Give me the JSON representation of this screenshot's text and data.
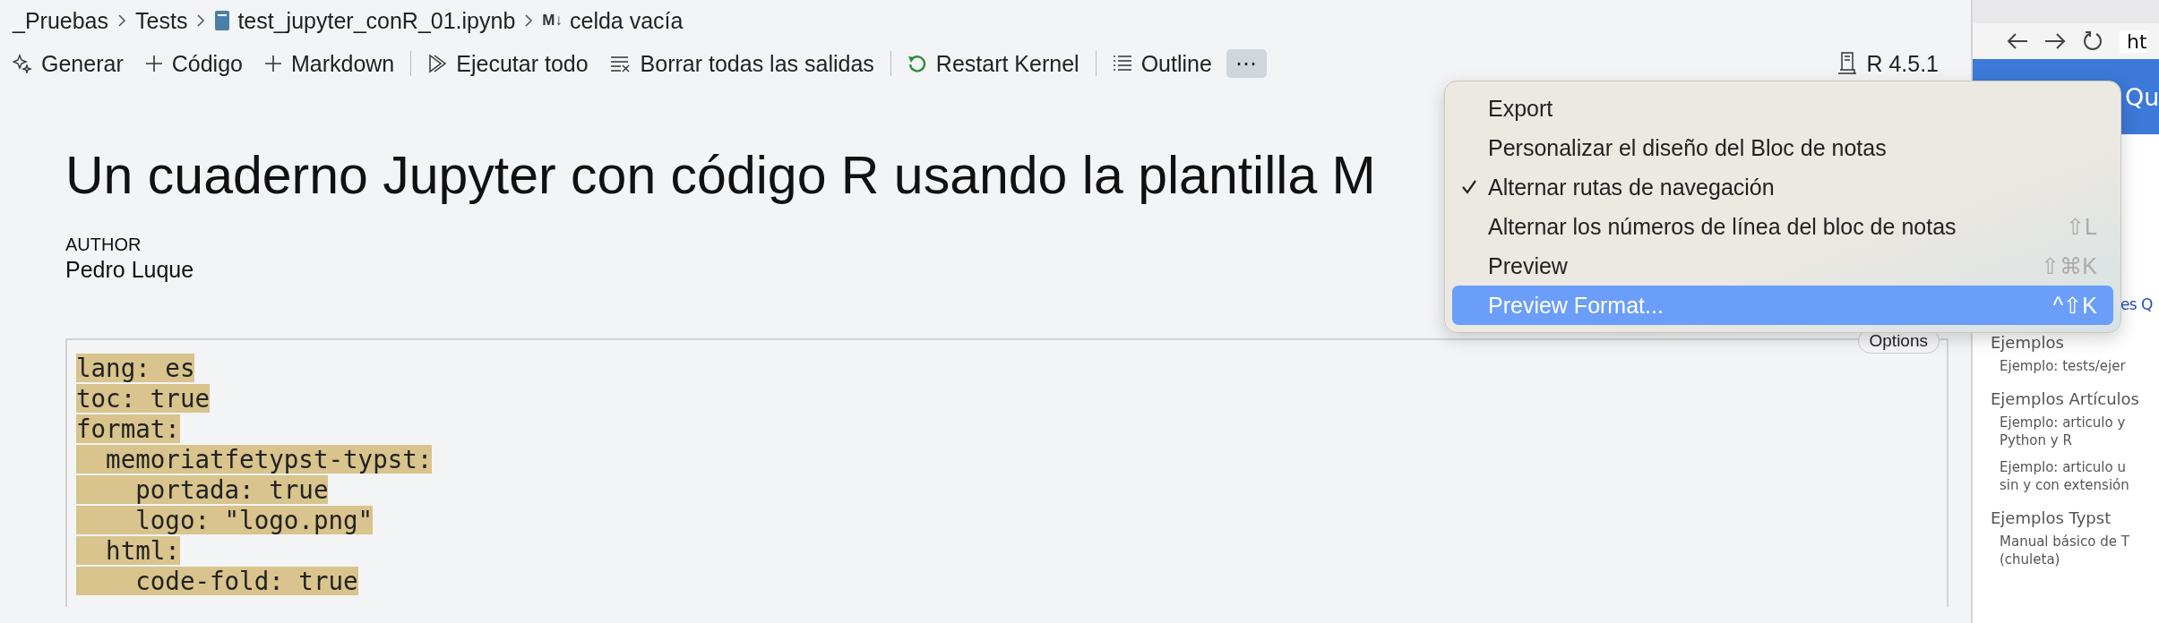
{
  "breadcrumb": [
    {
      "label": "_Pruebas",
      "kind": "folder"
    },
    {
      "label": "Tests",
      "kind": "folder"
    },
    {
      "label": "test_jupyter_conR_01.ipynb",
      "kind": "notebook"
    },
    {
      "label": "celda vacía",
      "kind": "markdown",
      "badge": "M↓"
    }
  ],
  "toolbar": [
    {
      "kind": "sparkle",
      "label": "Generar"
    },
    {
      "kind": "plus",
      "label": "Código"
    },
    {
      "kind": "plus",
      "label": "Markdown"
    },
    {
      "kind": "separator"
    },
    {
      "kind": "run",
      "label": "Ejecutar todo"
    },
    {
      "kind": "clear",
      "label": "Borrar todas las salidas"
    },
    {
      "kind": "separator"
    },
    {
      "kind": "restart",
      "label": "Restart Kernel"
    },
    {
      "kind": "separator"
    },
    {
      "kind": "outline",
      "label": "Outline"
    },
    {
      "kind": "more",
      "label": "⋯",
      "active": true
    }
  ],
  "kernel": {
    "label": "R 4.5.1"
  },
  "document": {
    "title": "Un cuaderno Jupyter con código R usando la plantilla M",
    "author_label": "AUTHOR",
    "author": "Pedro Luque",
    "options_badge": "Options"
  },
  "code": {
    "selected": true,
    "lines": [
      "lang: es",
      "toc: true",
      "format:",
      "  memoriatfetypst-typst:",
      "    portada: true",
      "    logo: \"logo.png\"",
      "  html:",
      "    code-fold: true"
    ]
  },
  "menu": {
    "items": [
      {
        "label": "Export",
        "checked": false,
        "selected": false
      },
      {
        "label": "Personalizar el diseño del Bloc de notas",
        "checked": false,
        "selected": false
      },
      {
        "label": "Alternar rutas de navegación",
        "checked": true,
        "selected": false
      },
      {
        "label": "Alternar los números de línea del bloc de notas",
        "checked": false,
        "selected": false,
        "shortcut": "⇧L"
      },
      {
        "label": "Preview",
        "checked": false,
        "selected": false,
        "shortcut": "⇧⌘K"
      },
      {
        "label": "Preview Format...",
        "checked": false,
        "selected": true,
        "shortcut": "^⇧K"
      }
    ]
  },
  "browser": {
    "url": "ht",
    "header": "Qu",
    "link": "es Q",
    "sections": [
      {
        "title": "Ejemplos",
        "items": [
          "Ejemplo: tests/ejer"
        ]
      },
      {
        "title": "Ejemplos Artículos",
        "items": [
          "Ejemplo: articulo y\nPython y R",
          "Ejemplo: articulo u\nsin y con extensión"
        ]
      },
      {
        "title": "Ejemplos Typst",
        "items": [
          "Manual básico de T\n(chuleta)"
        ]
      }
    ]
  }
}
